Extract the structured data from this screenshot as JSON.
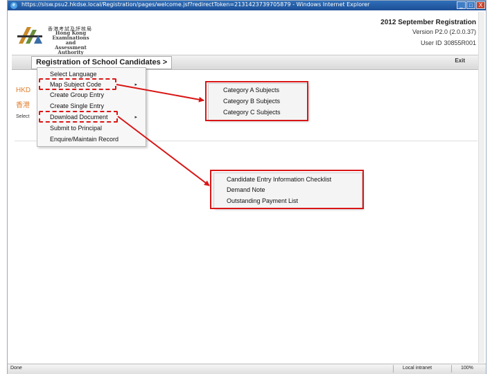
{
  "window": {
    "title": "https://slsw.psu2.hkdse.local/Registration/pages/welcome.jsf?redirectToken=2131423739705879 - Windows Internet Explorer",
    "btn_min": "_",
    "btn_max": "□",
    "btn_close": "X"
  },
  "header": {
    "logo_cn": "香港考試及評核局",
    "logo_en_line1": "Hong Kong",
    "logo_en_line2": "Examinations and",
    "logo_en_line3": "Assessment Authority",
    "registration_title": "2012 September Registration",
    "version": "Version P2.0 (2.0.0.37)",
    "user_id_label": "User ID",
    "user_id_value": "30855R001"
  },
  "menubar": {
    "title": "Registration of School Candidates >",
    "exit": "Exit"
  },
  "page": {
    "hkd_label": "HKD",
    "cn_label": "香港",
    "select_label": "Select"
  },
  "dropdown": {
    "items": [
      {
        "label": "Select Language"
      },
      {
        "label": "Map Subject Code"
      },
      {
        "label": "Create Group Entry"
      },
      {
        "label": "Create Single Entry"
      },
      {
        "label": "Download Document"
      },
      {
        "label": "Submit to Principal"
      },
      {
        "label": "Enquire/Maintain Record"
      }
    ],
    "arrow": "▸"
  },
  "submenu_map": {
    "items": [
      "Category A Subjects",
      "Category B Subjects",
      "Category C Subjects"
    ]
  },
  "submenu_download": {
    "items": [
      "Candidate Entry Information Checklist",
      "Demand Note",
      "Outstanding Payment List"
    ]
  },
  "status": {
    "left": "Done",
    "zone": "Local intranet",
    "zoom": "100%"
  },
  "colors": {
    "highlight": "#d91515",
    "title_bar": "#2f6fb9"
  }
}
